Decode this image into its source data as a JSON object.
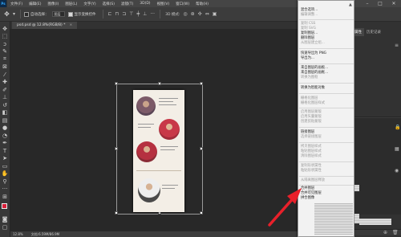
{
  "app": {
    "logo": "Ps"
  },
  "menubar": {
    "items": [
      "文件(F)",
      "编辑(E)",
      "图像(I)",
      "图层(L)",
      "文字(Y)",
      "选择(S)",
      "滤镜(T)",
      "3D(D)",
      "视图(V)",
      "窗口(W)",
      "帮助(H)"
    ],
    "minimize_glyph": "–",
    "maximize_glyph": "□",
    "close_glyph": "✕"
  },
  "options_bar": {
    "auto_select_label": "自动选择：",
    "auto_select_target": "图层",
    "show_transform_label": "显示变换控件"
  },
  "document_tab": {
    "title": "psd.psd @ 12.8%(RGB/8) *",
    "close_glyph": "×"
  },
  "statusbar": {
    "zoom": "12.8%",
    "doc_info": "文档:6.59M/86.9M"
  },
  "right_panel": {
    "tabs": [
      "属性",
      "历史记录"
    ]
  },
  "context_menu": {
    "items": [
      {
        "label": "混合选项...",
        "enabled": true
      },
      {
        "label": "编辑调整...",
        "enabled": false
      },
      {
        "label": "复制 CSS",
        "enabled": false
      },
      {
        "label": "复制 SVG",
        "enabled": false
      },
      {
        "label": "复制图层...",
        "enabled": true
      },
      {
        "label": "删除图层",
        "enabled": true
      },
      {
        "label": "从图层建立组...",
        "enabled": false
      },
      {
        "label": "快速导出为 PNG",
        "enabled": true
      },
      {
        "label": "导出为...",
        "enabled": true
      },
      {
        "label": "来自图层的画板...",
        "enabled": true
      },
      {
        "label": "来自图层的画框...",
        "enabled": true
      },
      {
        "label": "转换为图框",
        "enabled": false
      },
      {
        "label": "转换为智能对象",
        "enabled": true
      },
      {
        "label": "栅格化图层",
        "enabled": false
      },
      {
        "label": "栅格化图层样式",
        "enabled": false
      },
      {
        "label": "启用图层蒙版",
        "enabled": false
      },
      {
        "label": "启用矢量蒙版",
        "enabled": false
      },
      {
        "label": "创建剪贴蒙版",
        "enabled": false
      },
      {
        "label": "链接图层",
        "enabled": true
      },
      {
        "label": "选择链接图层",
        "enabled": false
      },
      {
        "label": "拷贝图层样式",
        "enabled": false
      },
      {
        "label": "粘贴图层样式",
        "enabled": false
      },
      {
        "label": "清除图层样式",
        "enabled": false
      },
      {
        "label": "复制形状属性",
        "enabled": false
      },
      {
        "label": "粘贴形状属性",
        "enabled": false
      },
      {
        "label": "从隔离图层释放",
        "enabled": false
      },
      {
        "label": "合并图层",
        "enabled": true
      },
      {
        "label": "合并可见图层",
        "enabled": true
      },
      {
        "label": "拼合图像",
        "enabled": true
      }
    ]
  },
  "colors": {
    "foreground": "#d8203a",
    "background": "#111111",
    "arrow": "#e8202a"
  }
}
